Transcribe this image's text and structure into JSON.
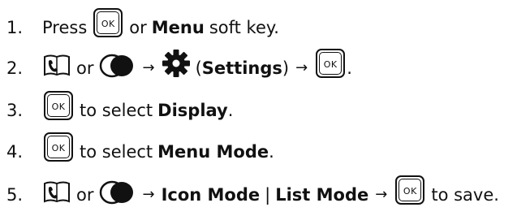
{
  "steps": [
    {
      "num": "1.",
      "t1": "Press",
      "t2": "or",
      "b1": "Menu",
      "t3": "soft key."
    },
    {
      "num": "2.",
      "t1": "or",
      "t2": "(",
      "b1": "Settings",
      "t3": ")",
      "t4": "."
    },
    {
      "num": "3.",
      "t1": "to select",
      "b1": "Display",
      "t2": "."
    },
    {
      "num": "4.",
      "t1": "to select",
      "b1": "Menu Mode",
      "t2": "."
    },
    {
      "num": "5.",
      "t1": "or",
      "b1": "Icon Mode",
      "t2": "|",
      "b2": "List Mode",
      "t3": "to save."
    }
  ],
  "keys": {
    "ok": "OK",
    "arrow": "→"
  },
  "icons": [
    "ok-key-icon",
    "phonebook-icon",
    "nav-key-icon",
    "settings-gear-icon"
  ]
}
